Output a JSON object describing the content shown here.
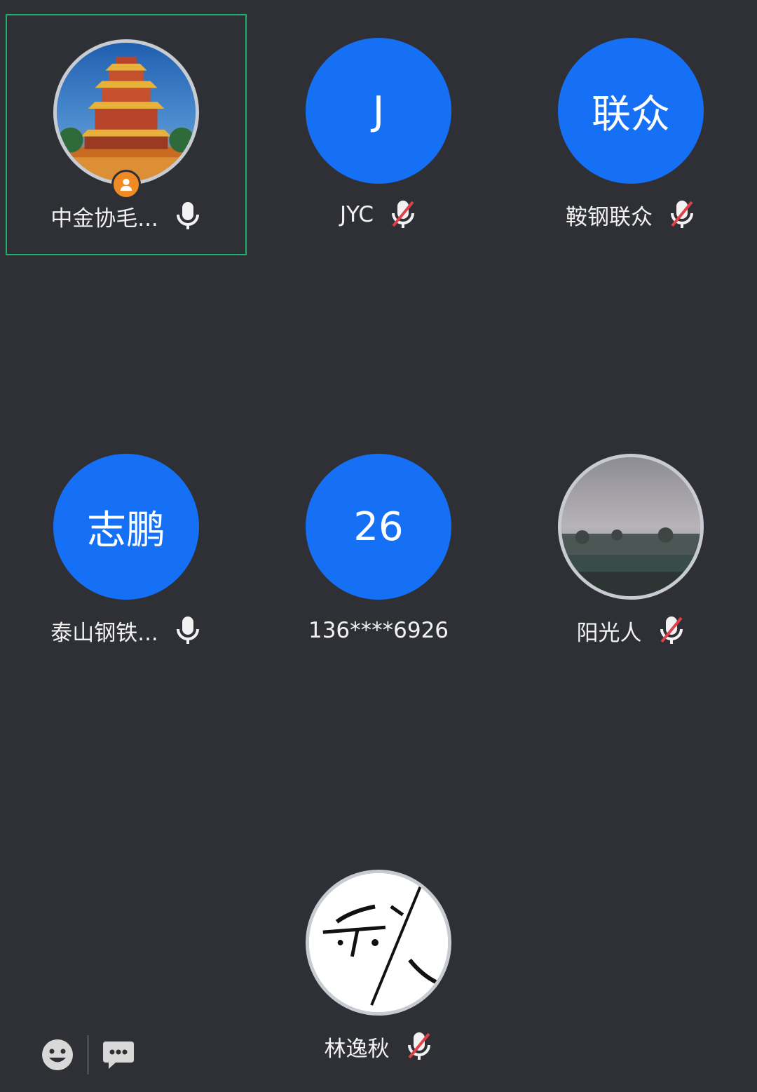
{
  "participants": [
    {
      "name": "中金协毛...",
      "avatar_type": "photo",
      "photo_subject": "pagoda-at-night",
      "is_host": true,
      "mic": "on",
      "active": true
    },
    {
      "name": "JYC",
      "avatar_type": "text",
      "avatar_text": "J",
      "is_host": false,
      "mic": "muted"
    },
    {
      "name": "鞍钢联众",
      "avatar_type": "text",
      "avatar_text": "联众",
      "is_host": false,
      "mic": "muted"
    },
    {
      "name": "泰山钢铁...",
      "avatar_type": "text",
      "avatar_text": "志鹏",
      "is_host": false,
      "mic": "on"
    },
    {
      "name": "136****6926",
      "avatar_type": "text",
      "avatar_text": "26",
      "is_host": false,
      "mic": "none"
    },
    {
      "name": "阳光人",
      "avatar_type": "photo",
      "photo_subject": "misty-field",
      "is_host": false,
      "mic": "muted"
    },
    {
      "name": "林逸秋",
      "avatar_type": "photo",
      "photo_subject": "calligraphy",
      "is_host": false,
      "mic": "muted"
    }
  ],
  "toolbar": {
    "emoji_icon": "emoji-icon",
    "chat_icon": "chat-icon"
  },
  "colors": {
    "background": "#2e3035",
    "avatar_blue": "#1670f5",
    "active_border": "#1fae6b",
    "host_badge": "#f08a24",
    "muted_slash": "#e0404a"
  }
}
